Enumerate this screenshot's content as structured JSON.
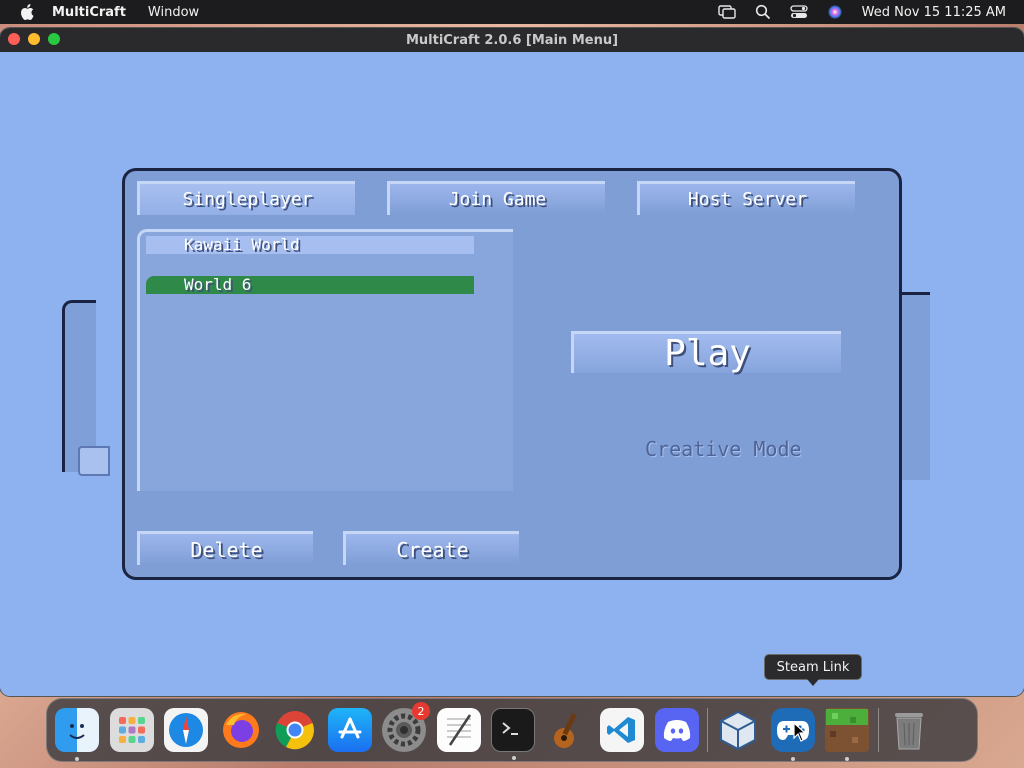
{
  "menubar": {
    "app_name": "MultiCraft",
    "menus": [
      "Window"
    ],
    "datetime": "Wed Nov 15  11:25 AM",
    "status_icons": [
      "screen-mirroring-icon",
      "spotlight-search-icon",
      "control-center-icon",
      "siri-icon"
    ]
  },
  "window": {
    "title": "MultiCraft 2.0.6 [Main Menu]"
  },
  "tabs": [
    {
      "label": "Singleplayer",
      "active": true
    },
    {
      "label": "Join Game",
      "active": false
    },
    {
      "label": "Host Server",
      "active": false
    }
  ],
  "worlds": [
    {
      "name": "Kawaii World",
      "selected": false
    },
    {
      "name": "World 6",
      "selected": true
    }
  ],
  "buttons": {
    "play": "Play",
    "delete": "Delete",
    "create": "Create"
  },
  "mode_label": "Creative Mode",
  "tooltip": "Steam Link",
  "dock": {
    "apps": [
      {
        "name": "finder-icon",
        "running": true
      },
      {
        "name": "launchpad-icon",
        "running": false
      },
      {
        "name": "safari-icon",
        "running": false
      },
      {
        "name": "firefox-icon",
        "running": false
      },
      {
        "name": "chrome-icon",
        "running": false
      },
      {
        "name": "app-store-icon",
        "running": false
      },
      {
        "name": "system-settings-icon",
        "running": false,
        "badge": "2"
      },
      {
        "name": "textedit-icon",
        "running": false
      },
      {
        "name": "terminal-icon",
        "running": true
      },
      {
        "name": "garageband-icon",
        "running": false
      },
      {
        "name": "vscode-icon",
        "running": false
      },
      {
        "name": "discord-icon",
        "running": false
      },
      {
        "name": "virtualbox-icon",
        "running": false
      },
      {
        "name": "steam-link-icon",
        "running": true
      },
      {
        "name": "multicraft-icon",
        "running": true
      },
      {
        "name": "trash-icon",
        "running": false
      }
    ]
  },
  "colors": {
    "game_background": "#8db2ef",
    "panel": "#7f9ed6",
    "selected_row": "#2f8a4a",
    "border_dark": "#1b2440"
  }
}
